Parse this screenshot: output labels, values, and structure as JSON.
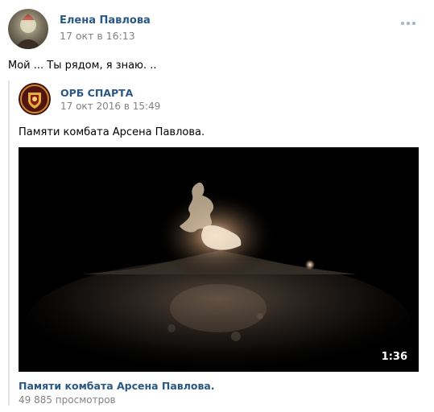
{
  "post": {
    "author": "Елена Павлова",
    "date": "17 окт в 16:13",
    "text": "Мой ... Ты рядом, я знаю. ..",
    "more_icon": "more-dots-icon"
  },
  "repost": {
    "author": "ОРБ СПАРТА",
    "date": "17 окт 2016 в 15:49",
    "text": "Памяти комбата Арсена Павлова."
  },
  "video": {
    "duration": "1:36",
    "title": "Памяти комбата Арсена Павлова.",
    "views": "49 885 просмотров"
  },
  "colors": {
    "link": "#2a5885",
    "meta": "#828282",
    "video_bg": "#000000"
  }
}
